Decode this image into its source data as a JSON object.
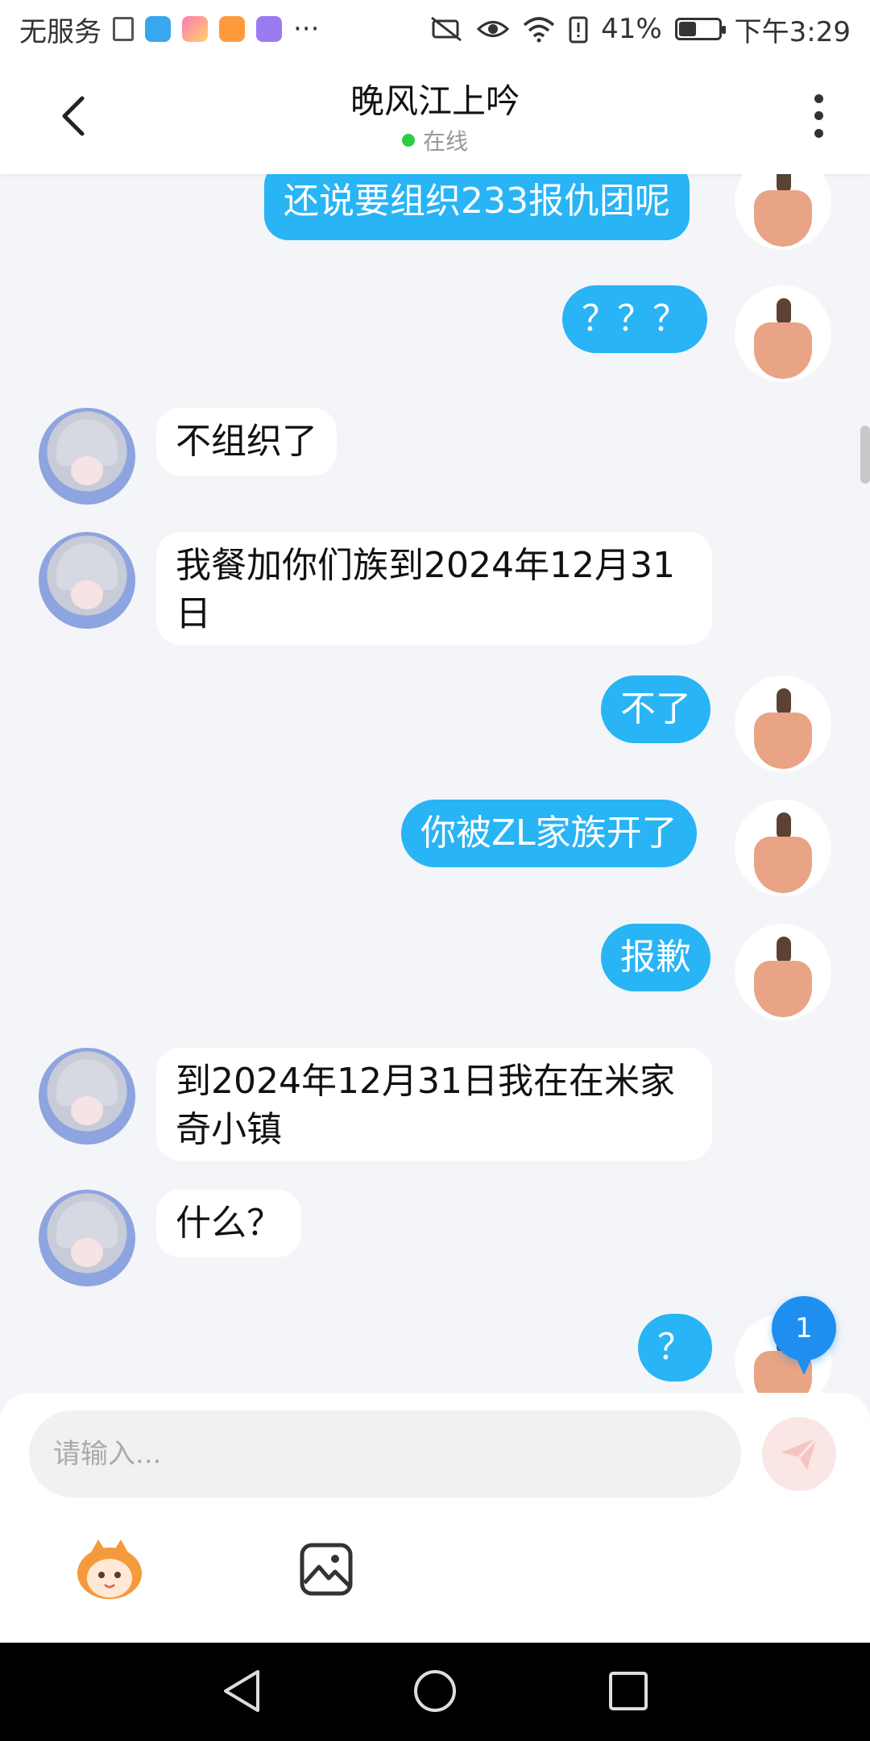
{
  "status_bar": {
    "carrier": "无服务",
    "more": "···",
    "battery": "41%",
    "battery_level": 0.41,
    "time": "下午3:29"
  },
  "header": {
    "title": "晚风江上吟",
    "status": "在线"
  },
  "messages": [
    {
      "from": "self",
      "text": "还说要组织233报仇团呢"
    },
    {
      "from": "self",
      "text": "？？？"
    },
    {
      "from": "other",
      "text": "不组织了"
    },
    {
      "from": "other",
      "text": "我餐加你们族到2024年12月31日"
    },
    {
      "from": "self",
      "text": "不了"
    },
    {
      "from": "self",
      "text": "你被ZL家族开了"
    },
    {
      "from": "self",
      "text": "报歉"
    },
    {
      "from": "other",
      "text": "到2024年12月31日我在在米家奇小镇"
    },
    {
      "from": "other",
      "text": "什么？"
    },
    {
      "from": "self",
      "text": "？"
    }
  ],
  "unread_badge": "1",
  "input": {
    "placeholder": "请输入..."
  },
  "colors": {
    "outgoing_bubble": "#28b4f5",
    "incoming_bubble": "#ffffff",
    "online": "#2ecc40",
    "badge": "#1e8ff0"
  }
}
